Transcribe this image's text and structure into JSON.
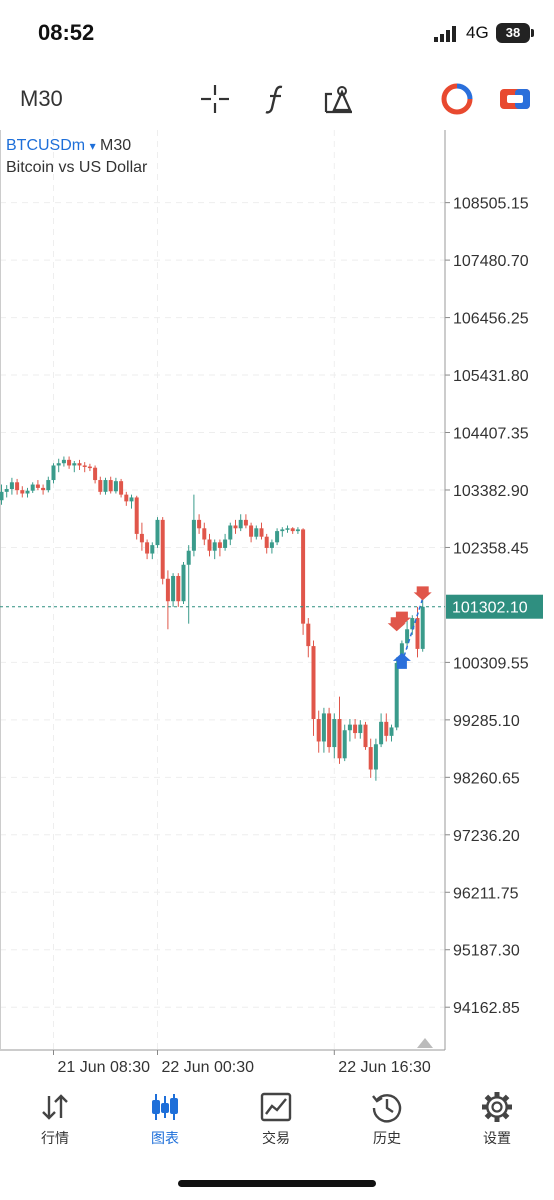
{
  "status": {
    "time": "08:52",
    "network": "4G",
    "battery": "38"
  },
  "toolbar": {
    "timeframe": "M30",
    "icons": [
      "crosshair-icon",
      "function-icon",
      "objects-icon",
      "signal-status-icon",
      "one-click-trading-icon"
    ],
    "colors": {
      "red": "#e8492f",
      "blue": "#2a6fdb"
    }
  },
  "chart": {
    "symbol": "BTCUSDm",
    "symbol_arrow": "▾",
    "timeframe": "M30",
    "description": "Bitcoin vs US Dollar",
    "current_price": "101302.10",
    "colors": {
      "up": "#3a9b8b",
      "down": "#e0564a",
      "bid_line": "#2f8f80"
    }
  },
  "chart_data": {
    "type": "candlestick",
    "y_tick_labels": [
      "108505.15",
      "107480.70",
      "106456.25",
      "105431.80",
      "104407.35",
      "103382.90",
      "102358.45",
      "101302.10",
      "100309.55",
      "99285.10",
      "98260.65",
      "97236.20",
      "96211.75",
      "95187.30",
      "94162.85"
    ],
    "y_ticks": [
      108505.15,
      107480.7,
      106456.25,
      105431.8,
      104407.35,
      103382.9,
      102358.45,
      100309.55,
      99285.1,
      98260.65,
      97236.2,
      96211.75,
      95187.3,
      94162.85
    ],
    "ylim": [
      93400,
      109800
    ],
    "x_tick_labels": [
      "21 Jun 08:30",
      "22 Jun 00:30",
      "22 Jun 16:30"
    ],
    "bid_price": 101302.1,
    "candles": [
      [
        103200,
        103480,
        103120,
        103350
      ],
      [
        103350,
        103470,
        103250,
        103400
      ],
      [
        103400,
        103600,
        103300,
        103520
      ],
      [
        103520,
        103580,
        103300,
        103380
      ],
      [
        103380,
        103450,
        103250,
        103320
      ],
      [
        103320,
        103420,
        103250,
        103370
      ],
      [
        103370,
        103520,
        103330,
        103480
      ],
      [
        103480,
        103560,
        103380,
        103420
      ],
      [
        103420,
        103480,
        103300,
        103380
      ],
      [
        103380,
        103620,
        103340,
        103560
      ],
      [
        103560,
        103860,
        103500,
        103820
      ],
      [
        103820,
        103940,
        103700,
        103860
      ],
      [
        103860,
        103980,
        103800,
        103920
      ],
      [
        103920,
        103980,
        103760,
        103820
      ],
      [
        103820,
        103900,
        103700,
        103860
      ],
      [
        103860,
        103920,
        103740,
        103820
      ],
      [
        103820,
        103880,
        103700,
        103800
      ],
      [
        103800,
        103850,
        103720,
        103780
      ],
      [
        103780,
        103820,
        103500,
        103560
      ],
      [
        103560,
        103620,
        103300,
        103350
      ],
      [
        103350,
        103600,
        103300,
        103560
      ],
      [
        103560,
        103620,
        103320,
        103360
      ],
      [
        103360,
        103600,
        103320,
        103540
      ],
      [
        103540,
        103580,
        103250,
        103300
      ],
      [
        103300,
        103350,
        103100,
        103180
      ],
      [
        103180,
        103300,
        103050,
        103250
      ],
      [
        103250,
        103280,
        102500,
        102600
      ],
      [
        102600,
        102800,
        102300,
        102450
      ],
      [
        102450,
        102500,
        102150,
        102250
      ],
      [
        102250,
        102450,
        102150,
        102400
      ],
      [
        102400,
        102900,
        102350,
        102850
      ],
      [
        102850,
        102900,
        101700,
        101800
      ],
      [
        101800,
        101950,
        100900,
        101400
      ],
      [
        101400,
        101900,
        101300,
        101850
      ],
      [
        101850,
        101900,
        101300,
        101400
      ],
      [
        101400,
        102100,
        101350,
        102050
      ],
      [
        102050,
        102400,
        101000,
        102300
      ],
      [
        102300,
        103300,
        102200,
        102850
      ],
      [
        102850,
        102950,
        102600,
        102700
      ],
      [
        102700,
        102800,
        102400,
        102500
      ],
      [
        102500,
        102600,
        102200,
        102300
      ],
      [
        102300,
        102500,
        102150,
        102450
      ],
      [
        102450,
        102500,
        102200,
        102350
      ],
      [
        102350,
        102600,
        102300,
        102500
      ],
      [
        102500,
        102800,
        102400,
        102750
      ],
      [
        102750,
        102850,
        102600,
        102700
      ],
      [
        102700,
        102950,
        102650,
        102850
      ],
      [
        102850,
        102950,
        102700,
        102750
      ],
      [
        102750,
        102800,
        102450,
        102550
      ],
      [
        102550,
        102750,
        102500,
        102700
      ],
      [
        102700,
        102800,
        102500,
        102550
      ],
      [
        102550,
        102600,
        102250,
        102350
      ],
      [
        102350,
        102500,
        102250,
        102450
      ],
      [
        102450,
        102700,
        102400,
        102650
      ],
      [
        102650,
        102720,
        102550,
        102680
      ],
      [
        102680,
        102750,
        102620,
        102700
      ],
      [
        102700,
        102720,
        102600,
        102650
      ],
      [
        102650,
        102720,
        102600,
        102680
      ],
      [
        102680,
        102700,
        100800,
        101000
      ],
      [
        101000,
        101100,
        100400,
        100600
      ],
      [
        100600,
        100700,
        99000,
        99300
      ],
      [
        99300,
        99450,
        98700,
        98900
      ],
      [
        98900,
        99500,
        98700,
        99400
      ],
      [
        99400,
        99500,
        98700,
        98800
      ],
      [
        98800,
        99400,
        98600,
        99300
      ],
      [
        99300,
        99700,
        98500,
        98600
      ],
      [
        98600,
        99200,
        98550,
        99100
      ],
      [
        99100,
        99300,
        98900,
        99200
      ],
      [
        99200,
        99300,
        98950,
        99050
      ],
      [
        99050,
        99280,
        98950,
        99200
      ],
      [
        99200,
        99250,
        98750,
        98800
      ],
      [
        98800,
        98950,
        98250,
        98400
      ],
      [
        98400,
        98950,
        98200,
        98850
      ],
      [
        98850,
        99400,
        98800,
        99250
      ],
      [
        99250,
        99400,
        98900,
        99000
      ],
      [
        99000,
        99200,
        98900,
        99150
      ],
      [
        99150,
        100400,
        99100,
        100300
      ],
      [
        100300,
        100700,
        100200,
        100650
      ],
      [
        100650,
        101050,
        100550,
        100900
      ],
      [
        100900,
        101150,
        100800,
        101100
      ],
      [
        101100,
        101300,
        100400,
        100550
      ],
      [
        100550,
        101450,
        100500,
        101300
      ]
    ],
    "x_tick_candle_index": [
      10,
      30,
      64
    ],
    "trade_markers": [
      {
        "type": "sell",
        "candle_index": 76,
        "price": 100900
      },
      {
        "type": "sell",
        "candle_index": 77,
        "price": 101000
      },
      {
        "type": "buy",
        "candle_index": 77,
        "price": 100300
      },
      {
        "type": "sell",
        "candle_index": 81,
        "price": 101450
      }
    ]
  },
  "nav": [
    {
      "label": "行情",
      "icon": "quotes-icon"
    },
    {
      "label": "图表",
      "icon": "chart-icon",
      "active": true
    },
    {
      "label": "交易",
      "icon": "trade-icon"
    },
    {
      "label": "历史",
      "icon": "history-icon"
    },
    {
      "label": "设置",
      "icon": "settings-icon"
    }
  ]
}
